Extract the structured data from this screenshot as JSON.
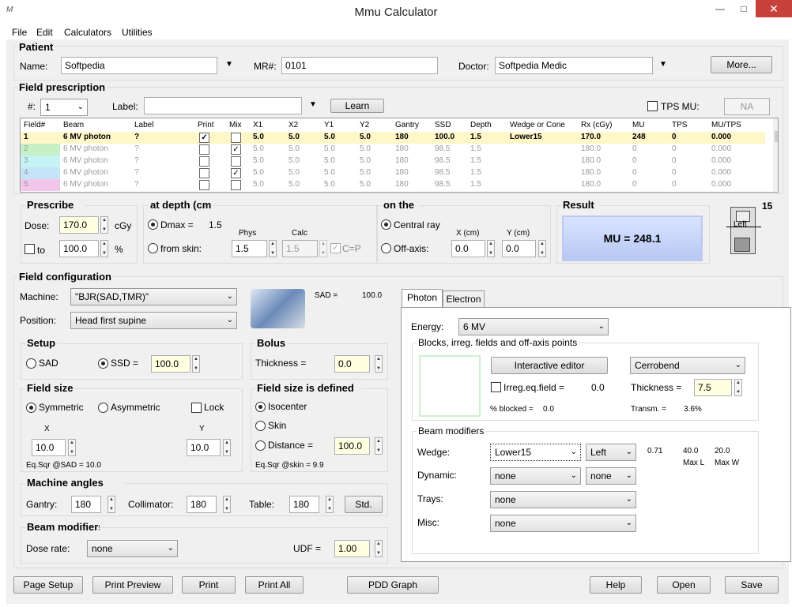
{
  "window": {
    "title": "Mmu Calculator",
    "icon": "M",
    "min": "—",
    "max": "□",
    "close": "✕"
  },
  "menu": [
    "File",
    "Edit",
    "Calculators",
    "Utilities"
  ],
  "patient": {
    "title": "Patient",
    "name_label": "Name:",
    "name": "Softpedia",
    "mr_label": "MR#:",
    "mr": "0101",
    "doctor_label": "Doctor:",
    "doctor": "Softpedia Medic",
    "more": "More..."
  },
  "rx": {
    "title": "Field prescription",
    "num_label": "#:",
    "num": "1",
    "label_label": "Label:",
    "label_value": "",
    "learn": "Learn",
    "tps_label": "TPS MU:",
    "tps_value": "NA"
  },
  "grid": {
    "headers": [
      "Field#",
      "Beam",
      "Label",
      "Print",
      "Mix",
      "X1",
      "X2",
      "Y1",
      "Y2",
      "Gantry",
      "SSD",
      "Depth",
      "Wedge or Cone",
      "Rx (cGy)",
      "MU",
      "TPS",
      "MU/TPS"
    ],
    "rows": [
      [
        "1",
        "6 MV photon",
        "?",
        "",
        "",
        "5.0",
        "5.0",
        "5.0",
        "5.0",
        "180",
        "100.0",
        "1.5",
        "Lower15",
        "170.0",
        "248",
        "0",
        "0.000"
      ],
      [
        "2",
        "6 MV photon",
        "?",
        "",
        "",
        "5.0",
        "5.0",
        "5.0",
        "5.0",
        "180",
        "98.5",
        "1.5",
        "",
        "180.0",
        "0",
        "0",
        "0.000"
      ],
      [
        "3",
        "6 MV photon",
        "?",
        "",
        "",
        "5.0",
        "5.0",
        "5.0",
        "5.0",
        "180",
        "98.5",
        "1.5",
        "",
        "180.0",
        "0",
        "0",
        "0.000"
      ],
      [
        "4",
        "6 MV photon",
        "?",
        "",
        "",
        "5.0",
        "5.0",
        "5.0",
        "5.0",
        "180",
        "98.5",
        "1.5",
        "",
        "180.0",
        "0",
        "0",
        "0.000"
      ],
      [
        "5",
        "6 MV photon",
        "?",
        "",
        "",
        "5.0",
        "5.0",
        "5.0",
        "5.0",
        "180",
        "98.5",
        "1.5",
        "",
        "180.0",
        "0",
        "0",
        "0.000"
      ]
    ],
    "print_checked": [
      true,
      false,
      false,
      false,
      false
    ],
    "mix_checked": [
      false,
      true,
      false,
      true,
      false
    ],
    "stripe_colors": [
      "#ffffff",
      "#c6f0c6",
      "#c6f4f4",
      "#c6e4f8",
      "#f4c6ec"
    ]
  },
  "prescribe": {
    "title": "Prescribe",
    "dose_label": "Dose:",
    "dose": "170.0",
    "dose_unit": "cGy",
    "to_label": "to",
    "to_value": "100.0",
    "to_unit": "%"
  },
  "depth": {
    "title": "at depth (cm",
    "dmax_label": "Dmax =",
    "dmax_value": "1.5",
    "phys_label": "Phys",
    "calc_label": "Calc",
    "skin_label": "from skin:",
    "phys": "1.5",
    "calc": "1.5",
    "cp_label": "C=P"
  },
  "onthe": {
    "title": "on the",
    "central_label": "Central ray",
    "offaxis_label": "Off-axis:",
    "x_label": "X (cm)",
    "y_label": "Y (cm)",
    "x": "0.0",
    "y": "0.0"
  },
  "result": {
    "title": "Result",
    "mu_text": "MU = 248.1",
    "count": "15",
    "icon_label": "Left"
  },
  "fieldconfig": {
    "title": "Field configuration",
    "machine_label": "Machine:",
    "machine": "\"BJR(SAD,TMR)\"",
    "position_label": "Position:",
    "position": "Head first supine",
    "sad_label": "SAD =",
    "sad_value": "100.0"
  },
  "setup": {
    "title": "Setup",
    "sad": "SAD",
    "ssd_label": "SSD =",
    "ssd": "100.0"
  },
  "bolus": {
    "title": "Bolus",
    "thick_label": "Thickness =",
    "thick": "0.0"
  },
  "fieldsize": {
    "title": "Field size",
    "sym": "Symmetric",
    "asym": "Asymmetric",
    "lock": "Lock",
    "x_label": "X",
    "y_label": "Y",
    "x": "10.0",
    "y": "10.0",
    "eqsqr": "Eq.Sqr @SAD = 10.0"
  },
  "definedat": {
    "title": "Field size is defined",
    "iso": "Isocenter",
    "skin": "Skin",
    "dist_label": "Distance =",
    "dist": "100.0",
    "eqsqr": "Eq.Sqr @skin = 9.9"
  },
  "angles": {
    "title": "Machine angles",
    "gantry_label": "Gantry:",
    "gantry": "180",
    "coll_label": "Collimator:",
    "coll": "180",
    "table_label": "Table:",
    "table": "180",
    "std": "Std."
  },
  "beammod": {
    "title": "Beam modifiers",
    "rate_label": "Dose rate:",
    "rate": "none",
    "udf_label": "UDF =",
    "udf": "1.00"
  },
  "tabs": {
    "photon": "Photon",
    "electron": "Electron"
  },
  "photon": {
    "energy_label": "Energy:",
    "energy": "6 MV",
    "blocks_title": "Blocks, irreg. fields and off-axis points",
    "interactive": "Interactive editor",
    "cerrobend": "Cerrobend",
    "irreg_label": "Irreg.eq.field =",
    "irreg_value": "0.0",
    "thick_label": "Thickness =",
    "thick": "7.5",
    "blocked_label": "% blocked =",
    "blocked_value": "0.0",
    "transm_label": "Transm. =",
    "transm_value": "3.6%"
  },
  "modifiers": {
    "title": "Beam modifiers",
    "wedge_label": "Wedge:",
    "wedge": "Lower15",
    "wedge_side": "Left",
    "wedge_factor": "0.71",
    "maxl_val": "40.0",
    "maxl_label": "Max L",
    "maxw_val": "20.0",
    "maxw_label": "Max W",
    "dynamic_label": "Dynamic:",
    "dynamic": "none",
    "dynamic2": "none",
    "trays_label": "Trays:",
    "trays": "none",
    "misc_label": "Misc:",
    "misc": "none"
  },
  "bottom": {
    "page_setup": "Page Setup",
    "print_preview": "Print Preview",
    "print": "Print",
    "print_all": "Print All",
    "pdd": "PDD Graph",
    "help": "Help",
    "open": "Open",
    "save": "Save"
  }
}
